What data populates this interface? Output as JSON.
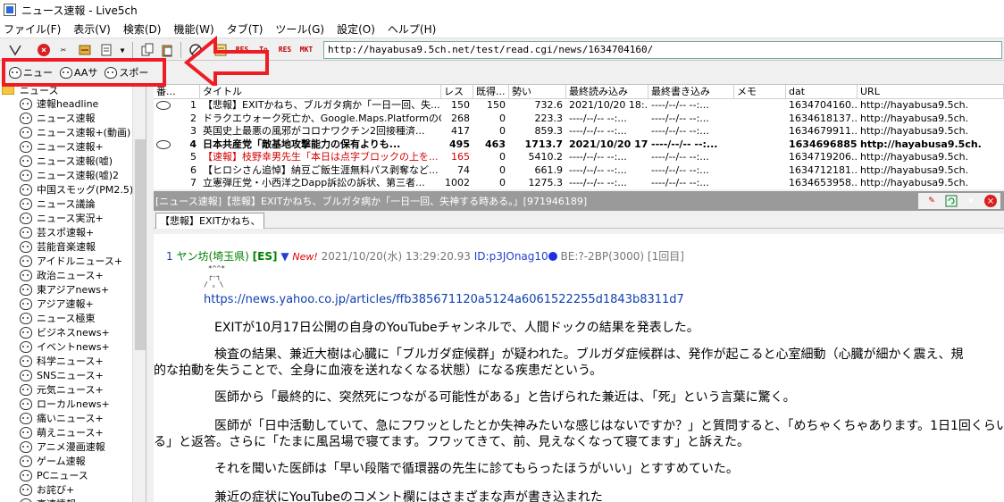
{
  "app": {
    "title": "ニュース速報 - Live5ch"
  },
  "menu": [
    "ファイル(F)",
    "表示(V)",
    "検索(D)",
    "機能(W)",
    "タブ(T)",
    "ツール(G)",
    "設定(O)",
    "ヘルプ(H)"
  ],
  "toolbar": {
    "url": "http://hayabusa9.5ch.net/test/read.cgi/news/1634704160/",
    "icons": [
      "go-icon",
      "stop-icon",
      "cut-icon",
      "tool-icon",
      "edit-icon",
      "copy-icon",
      "paste-icon",
      "search-icon",
      "board-icon",
      "res-icon",
      "to-icon",
      "res2-icon",
      "mkt-icon"
    ],
    "labels": {
      "res1": "RES",
      "to": "To",
      "res2": "RES",
      "mkt": "MKT"
    }
  },
  "board_tabs": [
    "ニュー",
    "AAサ",
    "スポー"
  ],
  "sidebar": {
    "folder": "ニュース",
    "items": [
      "速報headline",
      "ニュース速報",
      "ニュース速報+(動画)",
      "ニュース速報+",
      "ニュース速報(嘘)",
      "ニュース速報(嘘)2",
      "中国スモッグ(PM2.5)",
      "ニュース議論",
      "ニュース実況+",
      "芸スポ速報+",
      "芸能音楽速報",
      "アイドルニュース+",
      "政治ニュース+",
      "東アジアnews+",
      "アジア速報+",
      "ニュース極東",
      "ビジネスnews+",
      "イベントnews+",
      "科学ニュース+",
      "SNSニュース+",
      "元気ニュース+",
      "ローカルnews+",
      "痛いニュース+",
      "萌えニュース+",
      "アニメ漫画速報",
      "ゲーム速報",
      "PCニュース",
      "お詫び+",
      "高速情報"
    ]
  },
  "thread_list": {
    "columns": [
      "番...",
      "タイトル",
      "レス",
      "既得...",
      "勢い",
      "最終読み込み",
      "最終書き込み",
      "メモ",
      "dat",
      "URL"
    ],
    "rows": [
      {
        "icon": true,
        "num": "1",
        "title": "【悲報】EXITかねち、ブルガタ病か「一日一回、失...",
        "res": "150",
        "got": "150",
        "speed": "732.6",
        "last_read": "2021/10/20 18:...",
        "last_write": "----/--/-- --:...",
        "memo": "",
        "dat": "1634704160...",
        "url": "http://hayabusa9.5ch."
      },
      {
        "icon": false,
        "num": "2",
        "title": "ドラクエウォーク死亡か、Google.Maps.PlatformのG...",
        "res": "268",
        "got": "0",
        "speed": "223.3",
        "last_read": "----/--/-- --:...",
        "last_write": "----/--/-- --:...",
        "memo": "",
        "dat": "1634618137...",
        "url": "http://hayabusa9.5ch."
      },
      {
        "icon": false,
        "num": "3",
        "title": "英国史上最悪の風邪がコロナワクチン2回接種済...",
        "res": "417",
        "got": "0",
        "speed": "859.3",
        "last_read": "----/--/-- --:...",
        "last_write": "----/--/-- --:...",
        "memo": "",
        "dat": "1634679911...",
        "url": "http://hayabusa9.5ch."
      },
      {
        "icon": true,
        "num": "4",
        "title": "日本共産党「敵基地攻撃能力の保有よりも...",
        "res": "495",
        "got": "463",
        "speed": "1713.7",
        "last_read": "2021/10/20 17:...",
        "last_write": "----/--/-- --:...",
        "memo": "",
        "dat": "1634696885...",
        "url": "http://hayabusa9.5ch.",
        "style": "bold"
      },
      {
        "icon": false,
        "num": "5",
        "title": "【速報】枝野幸男先生「本日は点字ブロックの上を...",
        "res": "165",
        "got": "0",
        "speed": "5410.2",
        "last_read": "----/--/-- --:...",
        "last_write": "----/--/-- --:...",
        "memo": "",
        "dat": "1634719206...",
        "url": "http://hayabusa9.5ch.",
        "style": "red"
      },
      {
        "icon": false,
        "num": "6",
        "title": "【ヒロシさん追悼】納豆ご飯生涯無料パス剥奪など...",
        "res": "74",
        "got": "0",
        "speed": "661.9",
        "last_read": "----/--/-- --:...",
        "last_write": "----/--/-- --:...",
        "memo": "",
        "dat": "1634712181...",
        "url": "http://hayabusa9.5ch."
      },
      {
        "icon": false,
        "num": "7",
        "title": "立憲弾圧党・小西洋之Dapp訴訟の訴状、第三者...",
        "res": "1002",
        "got": "0",
        "speed": "1275.3",
        "last_read": "----/--/-- --:...",
        "last_write": "----/--/-- --:...",
        "memo": "",
        "dat": "1634653958...",
        "url": "http://hayabusa9.5ch."
      }
    ]
  },
  "thread": {
    "title_bar": "[ニュース速報]【悲報】EXITかねち、ブルガタ病か「一日一回、失神する時ある。」[971946189]",
    "tab": "【悲報】EXITかねち、",
    "post": {
      "num": "1",
      "name": "ヤン坊(埼玉県)",
      "tag": "[ES]",
      "tri": "▼",
      "new": "New!",
      "date": "2021/10/20(水) 13:29:20.93",
      "id": "ID:p3JOnag10",
      "be": "BE:?-2BP(3000)",
      "nth": "[1回目]",
      "aa": " *^^*\n ┌-┐\n/ 。\\",
      "link": "https://news.yahoo.co.jp/articles/ffb385671120a5124a6061522255d1843b8311d7",
      "paras": [
        "EXITが10月17日公開の自身のYouTubeチャンネルで、人間ドックの結果を発表した。",
        "検査の結果、兼近大樹は心臓に「ブルガダ症候群」が疑われた。ブルガダ症候群は、発作が起こると心室細動（心臓が細かく震え、規",
        "的な拍動を失うことで、全身に血液を送れなくなる状態）になる疾患だという。",
        "医師から「最終的に、突然死につながる可能性がある」と告げられた兼近は、「死」という言葉に驚く。",
        "医師が「日中活動していて、急にフワッとしたとか失神みたいな感じはないですか？」と質問すると、「めちゃくちゃあります。1日1回くらい",
        "る」と返答。さらに「たまに風呂場で寝てます。フワッてきて、前、見えなくなって寝てます」と訴えた。",
        "それを聞いた医師は「早い段階で循環器の先生に診てもらったほうがいい」とすすめていた。",
        "兼近の症状にYouTubeのコメント欄にはさまざまな声が書き込まれた"
      ]
    }
  },
  "colors": {
    "highlight": "#ee1c24",
    "toolbar_bg": "#f0f0f0",
    "title_bar_bg": "#9a9a9a"
  }
}
